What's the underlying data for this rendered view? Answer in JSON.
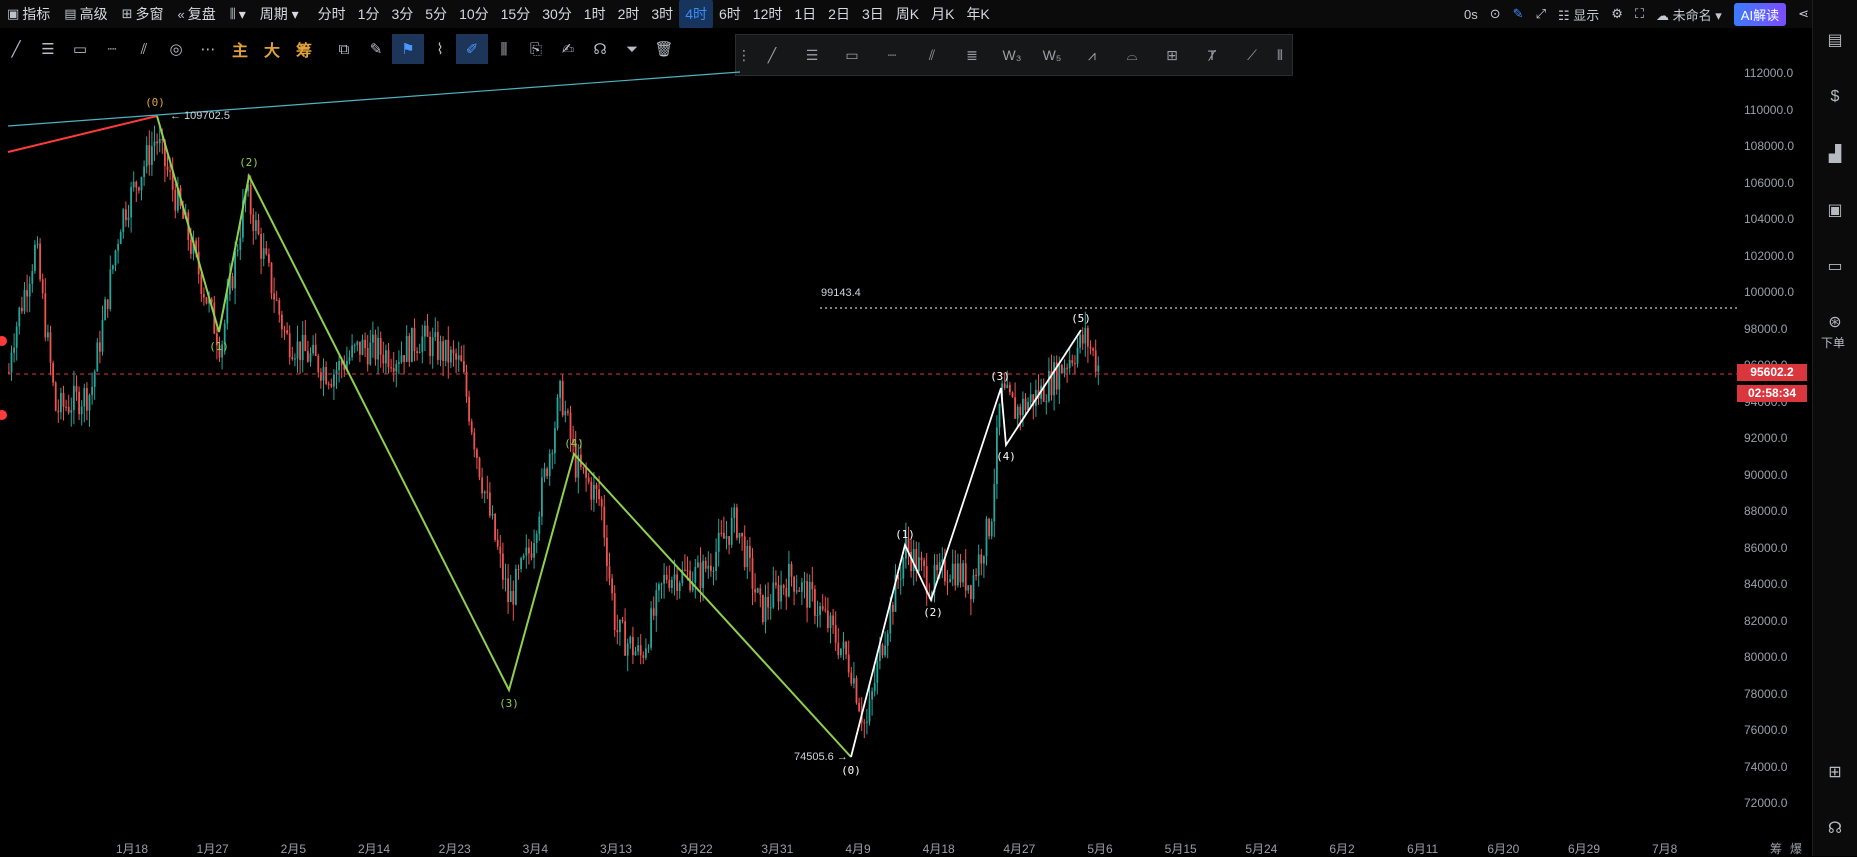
{
  "toolbar": {
    "left_items": [
      {
        "icon": "indicator-icon",
        "glyph": "▣",
        "label": "指标"
      },
      {
        "icon": "advanced-icon",
        "glyph": "▤",
        "label": "高级"
      },
      {
        "icon": "multi-window-icon",
        "glyph": "⊞",
        "label": "多窗"
      },
      {
        "icon": "replay-icon",
        "glyph": "«",
        "label": "复盘"
      },
      {
        "icon": "candle-type-icon",
        "glyph": "⫼",
        "label": "▾"
      },
      {
        "icon": "",
        "glyph": "",
        "label": "周期 ▾"
      }
    ],
    "periods": [
      "分时",
      "1分",
      "3分",
      "5分",
      "10分",
      "15分",
      "30分",
      "1时",
      "2时",
      "3时",
      "4时",
      "6时",
      "12时",
      "1日",
      "2日",
      "3日",
      "周K",
      "月K",
      "年K"
    ],
    "active_period": "4时",
    "right": {
      "timer": "0s",
      "display_label": "显示",
      "layout_label": "未命名 ▾",
      "ai_label": "AI解读"
    }
  },
  "drawing_tools": {
    "left": [
      {
        "name": "trendline-tool-icon",
        "glyph": "╱"
      },
      {
        "name": "horizontal-lines-tool-icon",
        "glyph": "☰"
      },
      {
        "name": "rectangle-tool-icon",
        "glyph": "▭"
      },
      {
        "name": "measure-tool-icon",
        "glyph": "┈"
      },
      {
        "name": "fib-tool-icon",
        "glyph": "⫽"
      },
      {
        "name": "spiral-tool-icon",
        "glyph": "◎"
      },
      {
        "name": "more-tools-icon",
        "glyph": "⋯"
      }
    ],
    "text_tools": [
      "主",
      "大",
      "筹"
    ],
    "right": [
      {
        "name": "screenshot-tool-icon",
        "glyph": "⧉"
      },
      {
        "name": "draw-mode-icon",
        "glyph": "✎"
      },
      {
        "name": "bookmark-icon",
        "glyph": "⚑",
        "selected": true
      },
      {
        "name": "ruler-icon",
        "glyph": "⌇"
      },
      {
        "name": "pen-icon",
        "glyph": "✐",
        "selected": true
      },
      {
        "name": "candle-icon",
        "glyph": "⫼"
      },
      {
        "name": "copy-icon",
        "glyph": "⎘"
      },
      {
        "name": "edit-icon",
        "glyph": "✍"
      },
      {
        "name": "magnet-icon",
        "glyph": "☊"
      },
      {
        "name": "filter-icon",
        "glyph": "⏷"
      },
      {
        "name": "trash-icon",
        "glyph": "🗑"
      }
    ]
  },
  "sub_tools": [
    {
      "name": "drag-handle-icon",
      "glyph": "⋮"
    },
    {
      "name": "line-tool-icon",
      "glyph": "╱"
    },
    {
      "name": "hlines-tool-icon",
      "glyph": "☰"
    },
    {
      "name": "rect-tool-icon",
      "glyph": "▭"
    },
    {
      "name": "dashed-tool-icon",
      "glyph": "┈"
    },
    {
      "name": "channel-tool-icon",
      "glyph": "⫽"
    },
    {
      "name": "grid-tool-icon",
      "glyph": "≣"
    },
    {
      "name": "wave-w3-icon",
      "glyph": "W₃"
    },
    {
      "name": "wave-w5-icon",
      "glyph": "W₅"
    },
    {
      "name": "pattern-tool-icon",
      "glyph": "⩘"
    },
    {
      "name": "arc-tool-icon",
      "glyph": "⌓"
    },
    {
      "name": "box-tool-icon",
      "glyph": "⊞"
    },
    {
      "name": "text-tool-icon",
      "glyph": "Ⱦ"
    },
    {
      "name": "brush-tool-icon",
      "glyph": "⟋"
    },
    {
      "name": "more-handle-icon",
      "glyph": "⦀"
    }
  ],
  "sidebar": {
    "order_label": "下单"
  },
  "price_axis": [
    "112000.0",
    "110000.0",
    "108000.0",
    "106000.0",
    "104000.0",
    "102000.0",
    "100000.0",
    "98000.0",
    "96000.0",
    "94000.0",
    "92000.0",
    "90000.0",
    "88000.0",
    "86000.0",
    "84000.0",
    "82000.0",
    "80000.0",
    "78000.0",
    "76000.0",
    "74000.0",
    "72000.0"
  ],
  "current_price": "95602.2",
  "countdown": "02:58:34",
  "time_axis": [
    "1月18",
    "1月27",
    "2月5",
    "2月14",
    "2月23",
    "3月4",
    "3月13",
    "3月22",
    "3月31",
    "4月9",
    "4月18",
    "4月27",
    "5月6",
    "5月15",
    "5月24",
    "6月2",
    "6月11",
    "6月20",
    "6月29",
    "7月8"
  ],
  "time_axis_right": [
    "筹",
    "爆"
  ],
  "annotations": {
    "high_label": "109702.5",
    "low_label": "74505.6",
    "level_label": "99143.4"
  },
  "waves": {
    "green": [
      "(0)",
      "(1)",
      "(2)",
      "(3)",
      "(4)"
    ],
    "white": [
      "(0)",
      "(1)",
      "(2)",
      "(3)",
      "(4)",
      "(5)"
    ]
  },
  "colors": {
    "up": "#26a69a",
    "down": "#ef5350",
    "green_wave": "#8fd14f",
    "white_wave": "#ffffff",
    "accent": "#3a8dff",
    "price_tag": "#d9363e",
    "trend_red": "#ff3b3b",
    "trend_teal": "#4fb3bf"
  }
}
